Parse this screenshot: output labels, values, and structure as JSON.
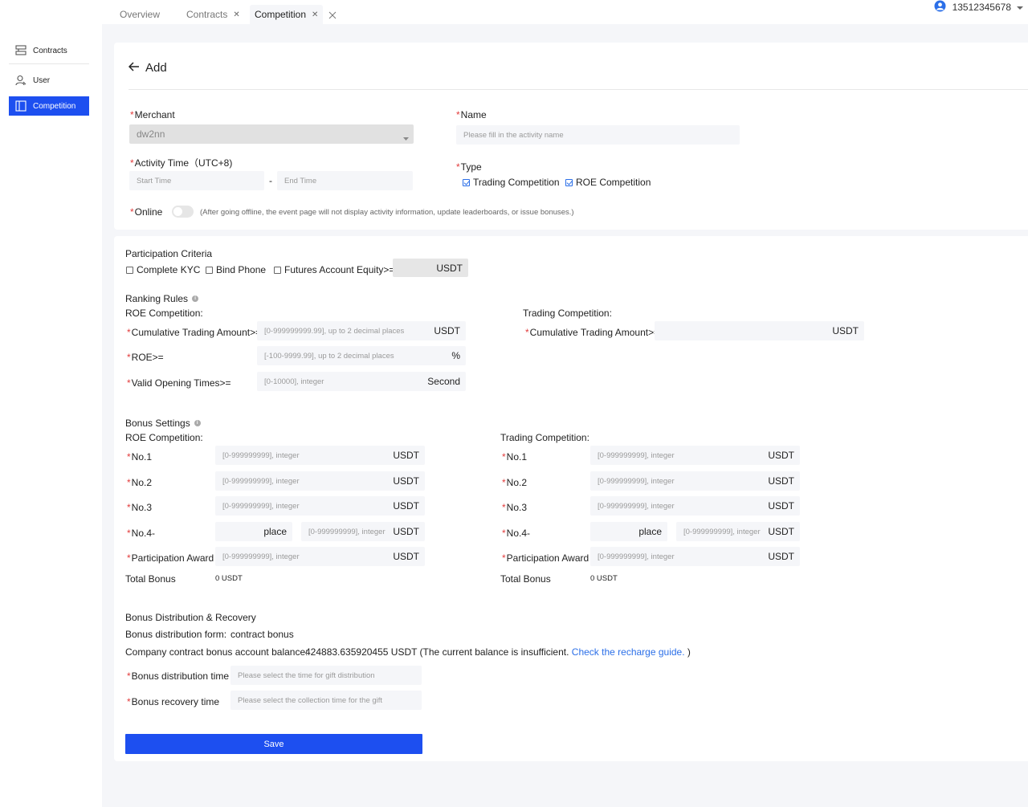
{
  "sidebar": {
    "items": [
      {
        "label": "Contracts",
        "icon": "contracts-icon"
      },
      {
        "label": "User",
        "icon": "user-icon"
      },
      {
        "label": "Competition",
        "icon": "competition-icon"
      }
    ]
  },
  "tabs": [
    {
      "label": "Overview"
    },
    {
      "label": "Contracts"
    },
    {
      "label": "Competition"
    }
  ],
  "user": {
    "phone": "13512345678"
  },
  "page": {
    "title": "Add"
  },
  "basic": {
    "merchant_label": "Merchant",
    "merchant_value": "dw2nn",
    "name_label": "Name",
    "name_placeholder": "Please fill in the activity name",
    "activity_time_label": "Activity Time（UTC+8)",
    "start_placeholder": "Start Time",
    "dash": "-",
    "end_placeholder": "End Time",
    "type_label": "Type",
    "type_trading": "Trading Competition",
    "type_roe": "ROE Competition",
    "online_label": "Online",
    "online_hint": "(After going offline, the event page will not display activity information, update leaderboards, or issue bonuses.)"
  },
  "criteria": {
    "title": "Participation Criteria",
    "kyc": "Complete KYC",
    "phone": "Bind Phone",
    "equity": "Futures Account Equity>=",
    "equity_unit": "USDT"
  },
  "ranking": {
    "title": "Ranking Rules",
    "roe_title": "ROE Competition:",
    "trading_title": "Trading Competition:",
    "cum_label": "Cumulative Trading Amount>=",
    "cum_placeholder": "[0-999999999.99], up to 2 decimal places",
    "cum_unit": "USDT",
    "roe_label": "ROE>=",
    "roe_placeholder": "[-100-9999.99], up to 2 decimal places",
    "roe_unit": "%",
    "open_label": "Valid Opening Times>=",
    "open_placeholder": "[0-10000], integer",
    "open_unit": "Second",
    "trading_cum_label": "Cumulative Trading Amount>=",
    "trading_cum_unit": "USDT"
  },
  "bonus": {
    "title": "Bonus Settings",
    "roe_title": "ROE Competition:",
    "trading_title": "Trading Competition:",
    "no1": "No.1",
    "no2": "No.2",
    "no3": "No.3",
    "no4": "No.4-",
    "participation": "Participation Award",
    "placeholder": "[0-999999999], integer",
    "unit": "USDT",
    "place": "place",
    "total_label": "Total Bonus",
    "roe_total": "0 USDT",
    "trading_total": "0 USDT"
  },
  "distribution": {
    "title": "Bonus Distribution & Recovery",
    "form_label": "Bonus distribution form:",
    "form_value": "contract bonus",
    "balance_label": "Company contract bonus account balance:",
    "balance_value": "424883.635920455 USDT (The current balance is insufficient.",
    "recharge_link": "Check the recharge guide.",
    "close_paren": ")",
    "dist_time_label": "Bonus distribution time",
    "dist_time_placeholder": "Please select the time for gift distribution",
    "recovery_label": "Bonus recovery time",
    "recovery_placeholder": "Please select the collection time for the gift",
    "save_label": "Save"
  },
  "colors": {
    "accent": "#1d4ff0",
    "required": "#e23c3c",
    "link": "#2b6fe8"
  }
}
